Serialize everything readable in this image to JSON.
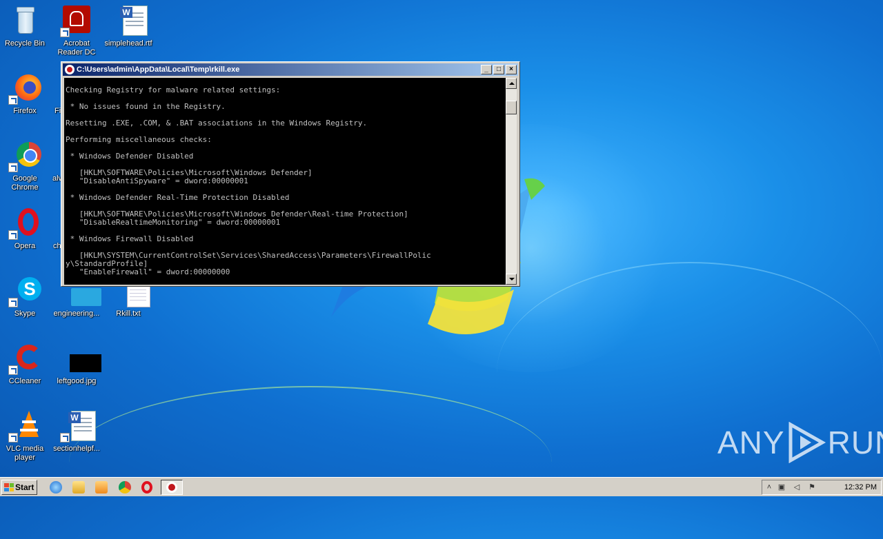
{
  "desktop": {
    "icons": [
      {
        "label": "Recycle Bin",
        "icon": "recycle-bin-icon"
      },
      {
        "label": "Acrobat Reader DC",
        "icon": "acrobat-icon"
      },
      {
        "label": "simplehead.rtf",
        "icon": "word-doc-icon"
      },
      {
        "label": "Firefox",
        "icon": "firefox-icon"
      },
      {
        "label": "Fi",
        "icon": "partial-icon"
      },
      {
        "label": "Google Chrome",
        "icon": "chrome-icon"
      },
      {
        "label": "alv",
        "icon": "partial-icon"
      },
      {
        "label": "Opera",
        "icon": "opera-icon"
      },
      {
        "label": "ch",
        "icon": "partial-icon"
      },
      {
        "label": "Skype",
        "icon": "skype-icon"
      },
      {
        "label": "engineering...",
        "icon": "folder-icon"
      },
      {
        "label": "Rkill.txt",
        "icon": "text-file-icon"
      },
      {
        "label": "CCleaner",
        "icon": "ccleaner-icon"
      },
      {
        "label": "leftgood.jpg",
        "icon": "image-file-icon"
      },
      {
        "label": "VLC media player",
        "icon": "vlc-icon"
      },
      {
        "label": "sectionhelpf...",
        "icon": "word-doc-icon"
      }
    ]
  },
  "window": {
    "title": "C:\\Users\\admin\\AppData\\Local\\Temp\\rkill.exe",
    "buttons": {
      "minimize": "_",
      "maximize": "□",
      "close": "×"
    },
    "console_lines": [
      "",
      "Checking Registry for malware related settings:",
      "",
      " * No issues found in the Registry.",
      "",
      "Resetting .EXE, .COM, & .BAT associations in the Windows Registry.",
      "",
      "Performing miscellaneous checks:",
      "",
      " * Windows Defender Disabled",
      "",
      "   [HKLM\\SOFTWARE\\Policies\\Microsoft\\Windows Defender]",
      "   \"DisableAntiSpyware\" = dword:00000001",
      "",
      " * Windows Defender Real-Time Protection Disabled",
      "",
      "   [HKLM\\SOFTWARE\\Policies\\Microsoft\\Windows Defender\\Real-time Protection]",
      "   \"DisableRealtimeMonitoring\" = dword:00000001",
      "",
      " * Windows Firewall Disabled",
      "",
      "   [HKLM\\SYSTEM\\CurrentControlSet\\Services\\SharedAccess\\Parameters\\FirewallPolic",
      "y\\StandardProfile]",
      "   \"EnableFirewall\" = dword:00000000"
    ]
  },
  "taskbar": {
    "start_label": "Start",
    "quicklaunch": [
      "ie-icon",
      "explorer-icon",
      "media-player-icon",
      "chrome-icon",
      "opera-icon"
    ],
    "task_icon": "rkill-icon",
    "clock": "12:32 PM"
  },
  "watermark": {
    "left": "ANY",
    "right": "RUN"
  },
  "colors": {
    "desktop": "#1a8fe8",
    "titlebar_start": "#0a246a",
    "titlebar_end": "#a6caf0",
    "console_bg": "#000000",
    "console_fg": "#c0c0c0"
  }
}
